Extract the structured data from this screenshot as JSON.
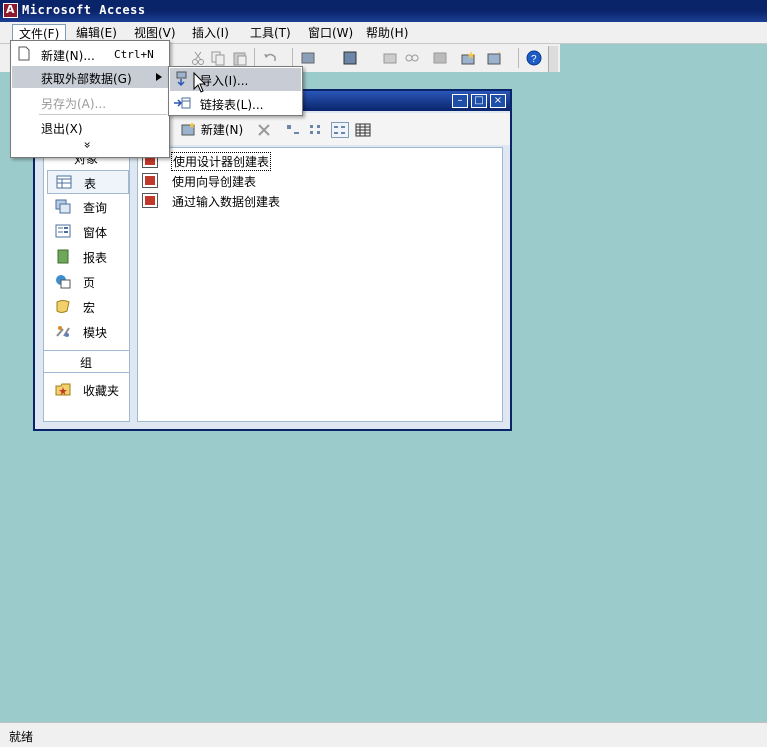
{
  "app": {
    "title": "Microsoft Access"
  },
  "menubar": {
    "items": [
      "文件(F)",
      "编辑(E)",
      "视图(V)",
      "插入(I)",
      "工具(T)",
      "窗口(W)",
      "帮助(H)"
    ]
  },
  "file_menu": {
    "new_label": "新建(N)...",
    "new_shortcut": "Ctrl+N",
    "get_external_label": "获取外部数据(G)",
    "save_as_label": "另存为(A)...",
    "exit_label": "退出(X)",
    "more_glyph": "»"
  },
  "submenu": {
    "import_label": "导入(I)...",
    "link_label": "链接表(L)..."
  },
  "db_window": {
    "new_button": "新建(N)",
    "objects_header": "对象",
    "objects": [
      "表",
      "查询",
      "窗体",
      "报表",
      "页",
      "宏",
      "模块"
    ],
    "groups_header": "组",
    "favorites": "收藏夹",
    "list_items": [
      "使用设计器创建表",
      "使用向导创建表",
      "通过输入数据创建表"
    ]
  },
  "status": {
    "text": "就绪"
  },
  "colors": {
    "titlebar": "#0a246a",
    "mdi_background": "#9ccbcb",
    "menu_highlight": "#c8ccd4"
  },
  "icons": [
    "access-app-icon",
    "new-doc-icon",
    "import-icon",
    "link-table-icon",
    "help-icon",
    "cursor-icon"
  ]
}
